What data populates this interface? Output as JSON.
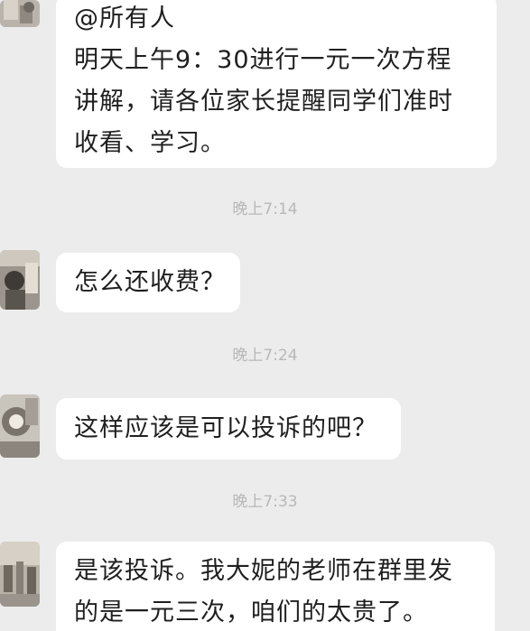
{
  "messages": [
    {
      "lines": [
        "@所有人",
        "明天上午9：30进行一元一次方程",
        "讲解，请各位家长提醒同学们准时",
        "收看、学习。"
      ]
    },
    {
      "time": "晚上7:14",
      "lines": [
        "怎么还收费？"
      ]
    },
    {
      "time": "晚上7:24",
      "lines": [
        "这样应该是可以投诉的吧？"
      ]
    },
    {
      "time": "晚上7:33",
      "lines": [
        "是该投诉。我大妮的老师在群里发",
        "的是一元三次，咱们的太贵了。"
      ]
    }
  ],
  "colors": {
    "background": "#ececec",
    "bubble": "#ffffff",
    "text": "#1f1f1f",
    "timestamp": "#b8b8b8"
  }
}
